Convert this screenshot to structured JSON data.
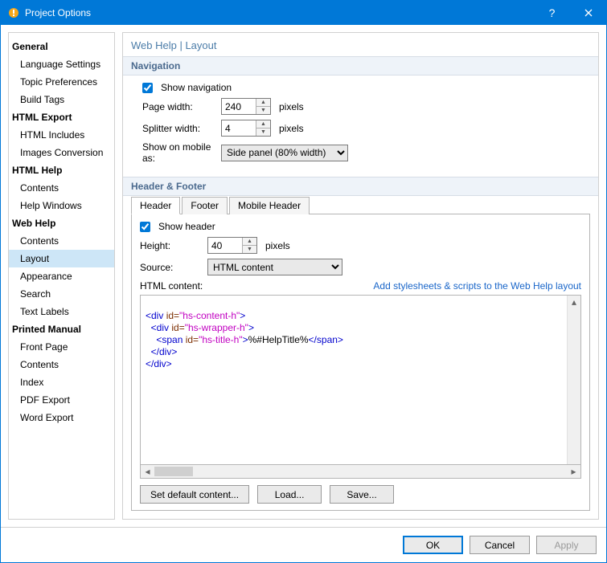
{
  "window": {
    "title": "Project Options"
  },
  "sidebar": {
    "groups": [
      {
        "head": "General",
        "items": [
          "Language Settings",
          "Topic Preferences",
          "Build Tags"
        ]
      },
      {
        "head": "HTML Export",
        "items": [
          "HTML Includes",
          "Images Conversion"
        ]
      },
      {
        "head": "HTML Help",
        "items": [
          "Contents",
          "Help Windows"
        ]
      },
      {
        "head": "Web Help",
        "items": [
          "Contents",
          "Layout",
          "Appearance",
          "Search",
          "Text Labels"
        ]
      },
      {
        "head": "Printed Manual",
        "items": [
          "Front Page",
          "Contents",
          "Index",
          "PDF Export",
          "Word Export"
        ]
      }
    ],
    "selected": "Layout"
  },
  "breadcrumb": "Web Help | Layout",
  "nav": {
    "title": "Navigation",
    "show_nav_label": "Show navigation",
    "show_nav_checked": true,
    "page_width_label": "Page width:",
    "page_width_value": "240",
    "splitter_width_label": "Splitter width:",
    "splitter_width_value": "4",
    "pixels": "pixels",
    "show_mobile_label": "Show on mobile as:",
    "show_mobile_value": "Side panel (80% width)"
  },
  "hf": {
    "title": "Header & Footer",
    "tabs": [
      "Header",
      "Footer",
      "Mobile Header"
    ],
    "active_tab": "Header",
    "show_header_label": "Show header",
    "show_header_checked": true,
    "height_label": "Height:",
    "height_value": "40",
    "pixels": "pixels",
    "source_label": "Source:",
    "source_value": "HTML content",
    "html_content_label": "HTML content:",
    "stylesheet_link": "Add stylesheets & scripts to the Web Help layout",
    "buttons": {
      "default": "Set default content...",
      "load": "Load...",
      "save": "Save..."
    },
    "code": {
      "l1a": "<div ",
      "l1b": "id=",
      "l1c": "\"hs-content-h\"",
      "l1d": ">",
      "l2a": "  <div ",
      "l2b": "id=",
      "l2c": "\"hs-wrapper-h\"",
      "l2d": ">",
      "l3a": "    <span ",
      "l3b": "id=",
      "l3c": "\"hs-title-h\"",
      "l3d": ">",
      "l3e": "%#HelpTitle%",
      "l3f": "</span>",
      "l4": "  </div>",
      "l5": "</div>"
    }
  },
  "footer": {
    "ok": "OK",
    "cancel": "Cancel",
    "apply": "Apply"
  }
}
